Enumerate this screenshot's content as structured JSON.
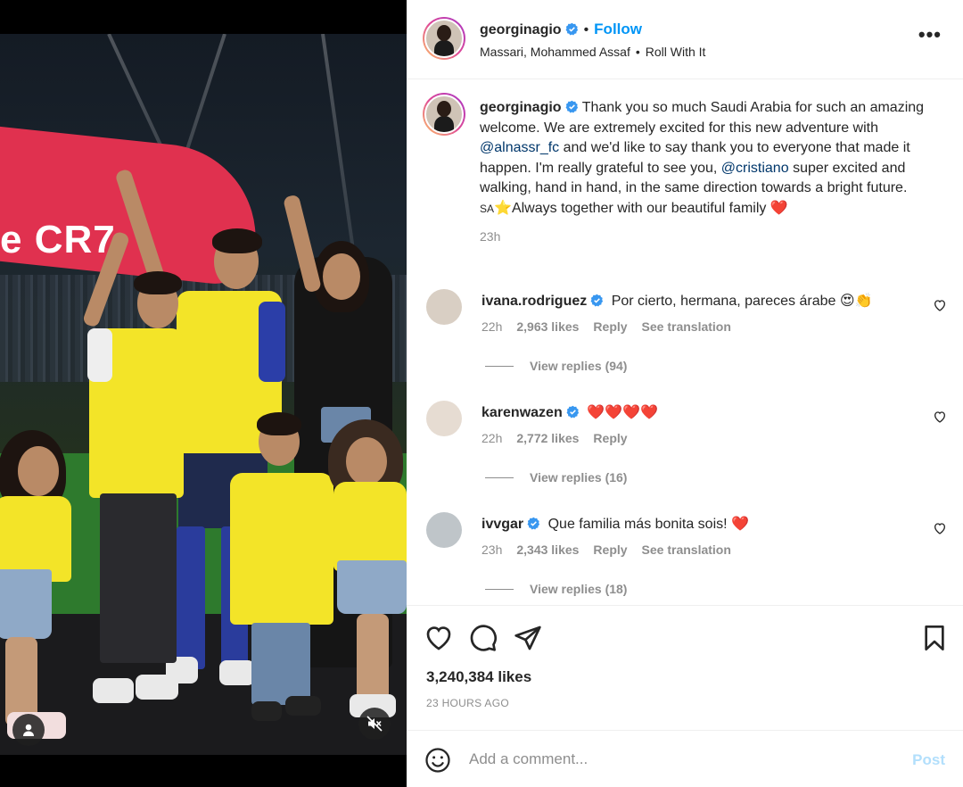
{
  "header": {
    "username": "georginagio",
    "separator": "•",
    "follow_label": "Follow",
    "audio_artist": "Massari, Mohammed Assaf",
    "audio_separator": "•",
    "audio_title": "Roll With It",
    "more_label": "•••"
  },
  "media": {
    "banner_text": "e CR7",
    "user_tag_icon": "user-icon",
    "mute_icon": "speaker-muted-icon"
  },
  "caption": {
    "username": "georginagio",
    "text_1": "Thank you so much Saudi Arabia for such an amazing welcome. We are extremely excited for this new adventure with",
    "mention_1": "@alnassr_fc",
    "text_2": "and we'd like to say thank you to everyone that made it happen. I'm really grateful to see you,",
    "mention_2": "@cristiano",
    "text_3": "super excited and walking, hand in hand, in the same direction towards a bright future.",
    "flag": "SA",
    "star": "⭐",
    "text_4": "Always together with our beautiful family",
    "heart": "❤️",
    "time": "23h"
  },
  "comments": [
    {
      "username": "ivana.rodriguez",
      "text": "Por cierto, hermana, pareces árabe 😍👏",
      "time": "22h",
      "likes": "2,963 likes",
      "reply_label": "Reply",
      "translate_label": "See translation",
      "replies_label": "View replies (94)"
    },
    {
      "username": "karenwazen",
      "text": "❤️❤️❤️❤️",
      "time": "22h",
      "likes": "2,772 likes",
      "reply_label": "Reply",
      "translate_label": "",
      "replies_label": "View replies (16)"
    },
    {
      "username": "ivvgar",
      "text": "Que familia más bonita sois! ❤️",
      "time": "23h",
      "likes": "2,343 likes",
      "reply_label": "Reply",
      "translate_label": "See translation",
      "replies_label": "View replies (18)"
    }
  ],
  "actions": {
    "likes": "3,240,384 likes",
    "time_ago": "23 HOURS AGO"
  },
  "add_comment": {
    "placeholder": "Add a comment...",
    "post_label": "Post"
  },
  "colors": {
    "link_blue": "#0095f6",
    "mention": "#00376b",
    "muted": "#8e8e8e",
    "verified": "#3897f0",
    "post_disabled": "#b2dffc"
  }
}
